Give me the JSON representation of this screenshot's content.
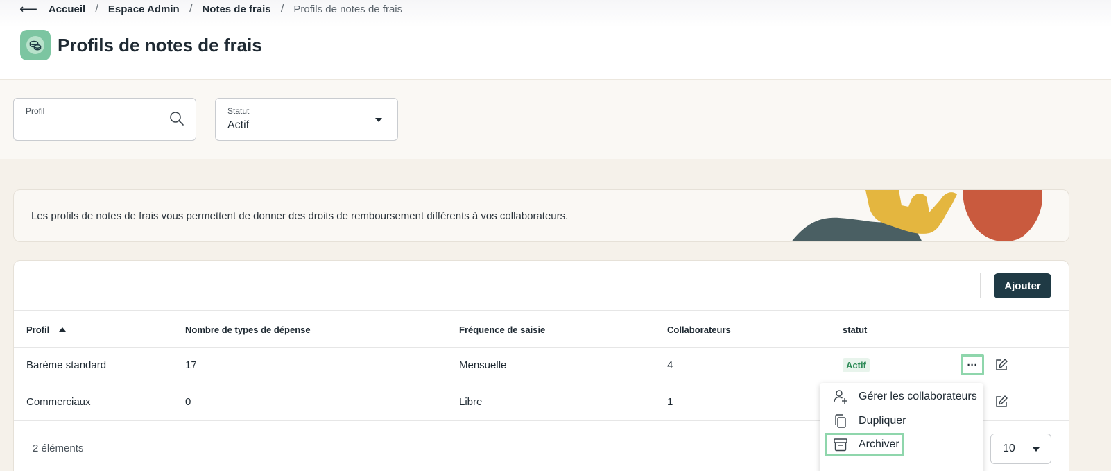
{
  "breadcrumb": {
    "back_icon": "arrow-left-icon",
    "items": [
      "Accueil",
      "Espace Admin",
      "Notes de frais",
      "Profils de notes de frais"
    ],
    "separator": "/"
  },
  "header": {
    "title": "Profils de notes de frais",
    "icon": "expense-coins-icon"
  },
  "filters": {
    "profile": {
      "label": "Profil",
      "value": ""
    },
    "status": {
      "label": "Statut",
      "value": "Actif"
    }
  },
  "banner": {
    "text": "Les profils de notes de frais vous permettent de donner des droits de remboursement différents à vos collaborateurs."
  },
  "toolbar": {
    "add_label": "Ajouter"
  },
  "table": {
    "columns": [
      "Profil",
      "Nombre de types de dépense",
      "Fréquence de saisie",
      "Collaborateurs",
      "statut"
    ],
    "rows": [
      {
        "profile": "Barème standard",
        "types": "17",
        "frequency": "Mensuelle",
        "collaborators": "4",
        "status": "Actif"
      },
      {
        "profile": "Commerciaux",
        "types": "0",
        "frequency": "Libre",
        "collaborators": "1",
        "status": ""
      }
    ],
    "more_label": "···"
  },
  "footer": {
    "count": "2 éléments",
    "per_page": "10"
  },
  "menu": {
    "items": [
      {
        "label": "Gérer les collaborateurs",
        "icon": "user-plus-icon"
      },
      {
        "label": "Dupliquer",
        "icon": "copy-icon"
      },
      {
        "label": "Archiver",
        "icon": "archive-icon"
      }
    ]
  },
  "colors": {
    "primary_dark": "#1f3a45",
    "accent_green": "#7cc5a1",
    "highlight": "#8fd6ac",
    "status_green": "#2e8b57"
  }
}
